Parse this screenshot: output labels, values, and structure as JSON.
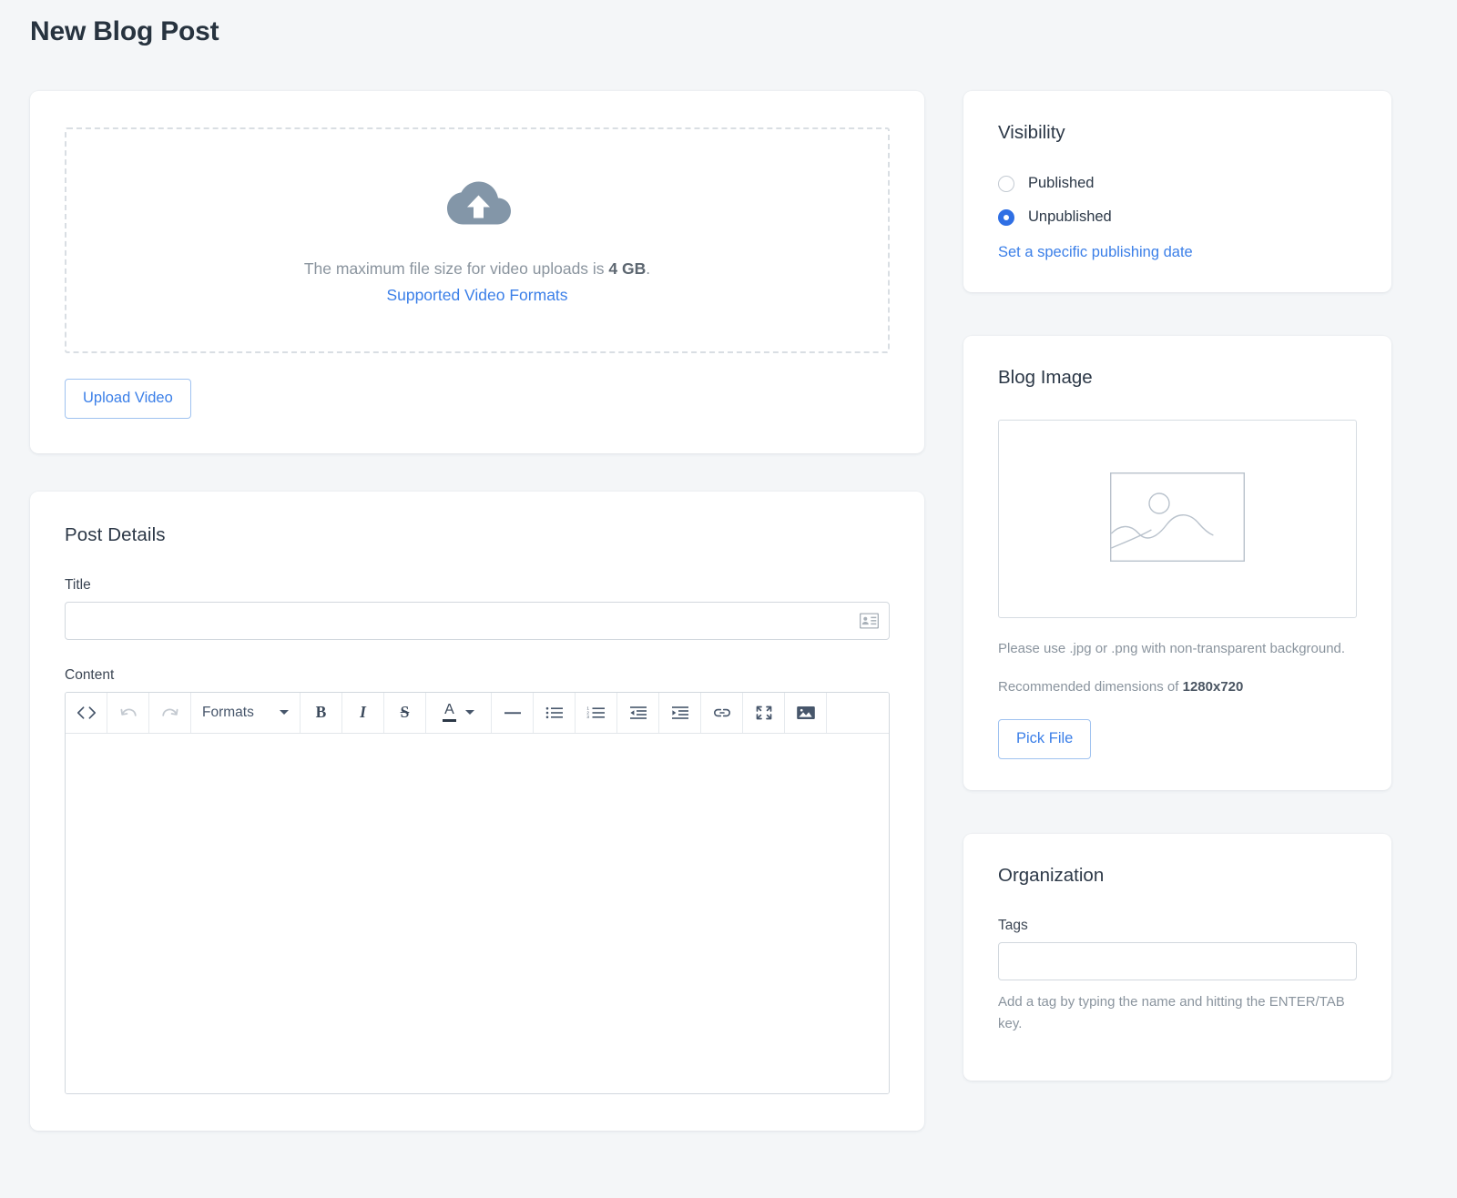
{
  "page": {
    "title": "New Blog Post",
    "background_color": "#f4f6f8",
    "accent_color": "#3b7fe8"
  },
  "upload": {
    "icon": "cloud-upload-icon",
    "message_prefix": "The maximum file size for video uploads is ",
    "max_size": "4 GB",
    "message_suffix": ".",
    "formats_link": "Supported Video Formats",
    "button_label": "Upload Video"
  },
  "post_details": {
    "heading": "Post Details",
    "title_label": "Title",
    "title_value": "",
    "title_placeholder": "",
    "title_trailing_icon": "contact-card-icon",
    "content_label": "Content",
    "content_value": "",
    "toolbar": {
      "source_code": "<>",
      "undo": "undo-icon",
      "redo": "redo-icon",
      "formats_label": "Formats",
      "bold": "B",
      "italic": "I",
      "strikethrough": "S",
      "text_color": "A",
      "horizontal_rule": "horizontal-rule-icon",
      "bullet_list": "bullet-list-icon",
      "numbered_list": "numbered-list-icon",
      "outdent": "outdent-icon",
      "indent": "indent-icon",
      "link": "link-icon",
      "fullscreen": "fullscreen-icon",
      "image": "image-icon"
    }
  },
  "visibility": {
    "heading": "Visibility",
    "options": [
      {
        "label": "Published",
        "checked": false
      },
      {
        "label": "Unpublished",
        "checked": true
      }
    ],
    "published_label": "Published",
    "unpublished_label": "Unpublished",
    "date_link": "Set a specific publishing date"
  },
  "blog_image": {
    "heading": "Blog Image",
    "preview_icon": "image-placeholder-icon",
    "help_line_1": "Please use .jpg or .png with non-transparent background.",
    "help_line_2_prefix": "Recommended dimensions of ",
    "recommended_dimensions": "1280x720",
    "button_label": "Pick File"
  },
  "organization": {
    "heading": "Organization",
    "tags_label": "Tags",
    "tags_value": "",
    "tags_placeholder": "",
    "tags_help": "Add a tag by typing the name and hitting the ENTER/TAB key."
  }
}
